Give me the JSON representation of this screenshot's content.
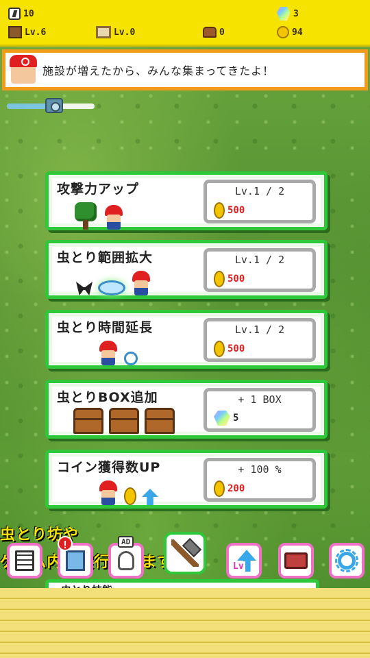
{
  "resources": {
    "players": "10",
    "gems": "3",
    "facility_level": "Lv.6",
    "board_level": "Lv.0",
    "chests": "0",
    "coins": "94"
  },
  "banner": {
    "message": "施設が増えたから、みんな集まってきたよ！"
  },
  "zoom_slider": {
    "value": 0.55
  },
  "upgrades": [
    {
      "title": "攻撃力アップ",
      "level": "Lv.1 / 2",
      "cost": "500",
      "currency": "coin"
    },
    {
      "title": "虫とり範囲拡大",
      "level": "Lv.1 / 2",
      "cost": "500",
      "currency": "coin"
    },
    {
      "title": "虫とり時間延長",
      "level": "Lv.1 / 2",
      "cost": "500",
      "currency": "coin"
    },
    {
      "title": "虫とりBOX追加",
      "level": "+ 1 BOX",
      "cost": "5",
      "currency": "gem"
    },
    {
      "title": "コイン獲得数UP",
      "level": "+ 100 %",
      "cost": "200",
      "currency": "coin"
    }
  ],
  "ticker": {
    "line1": "虫とり坊や",
    "line2": "ゲーム内で実行されます"
  },
  "peek_card": {
    "title": "虫とり技能"
  },
  "toolbar": {
    "ad_label": "AD",
    "alert_label": "!"
  },
  "colors": {
    "topbar": "#f6e400",
    "card_border": "#2fc83a",
    "banner_border": "#f39a1a",
    "price_text": "#e02020",
    "toolbar_border": "#f070c8"
  }
}
